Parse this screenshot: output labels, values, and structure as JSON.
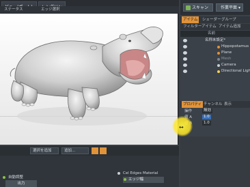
{
  "viewport_tabs": [
    "ビュー(ポート)",
    "レンダリング"
  ],
  "viewport_row2": [
    "ステータス",
    "エッジ選択"
  ],
  "right_panel": {
    "top_buttons": [
      "スキャン",
      "作業平面"
    ],
    "tabs": [
      "アイテム",
      "シェーダー",
      "グループ"
    ],
    "tabs2": [
      "フィルターアイテム",
      "アイテム追加"
    ],
    "list_header": [
      "名前"
    ],
    "items": [
      "名称未設定*",
      "Hippopotamus 01.0",
      "Plane",
      "Mesh",
      "Camera",
      "Directional Light"
    ],
    "prop_tabs": [
      "プロパティ",
      "チャンネル",
      "表示"
    ],
    "props": [
      {
        "name": "操作",
        "value": "無効"
      },
      {
        "name": "値 A",
        "value": "1.0"
      },
      {
        "name": "値 B",
        "value": "1.0"
      }
    ]
  },
  "schematic": {
    "toolbar": [
      "選択を追加",
      "追加..."
    ],
    "node_left": {
      "header": "自動調整",
      "body": "出力"
    },
    "node_right": {
      "header": "Cel Edges Material",
      "body": "エッジ幅"
    }
  }
}
